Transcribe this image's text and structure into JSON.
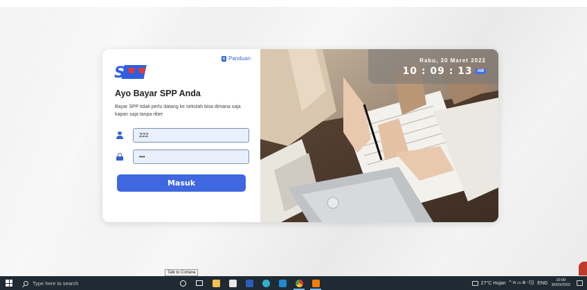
{
  "app": {
    "logo_text": "SPP",
    "guide_link": "Panduan",
    "title": "Ayo Bayar SPP Anda",
    "subtitle": "Bayar SPP tidak perlu datang ke sekolah bisa dimana saja kapan saja tanpa ribet",
    "username_value": "222",
    "password_value": "•••",
    "login_button": "Masuk"
  },
  "clock_panel": {
    "date": "Rabu, 30 Maret 2022",
    "time": "10 : 09 : 13",
    "ampm": "AM"
  },
  "tooltip": "Talk to Cortana",
  "taskbar": {
    "search_placeholder": "Type here to search",
    "pinned_icons": [
      "cortana-icon",
      "task-view-icon",
      "file-explorer-icon",
      "mail-icon",
      "word-icon",
      "edge-icon",
      "vscode-icon",
      "chrome-icon",
      "xampp-icon"
    ],
    "weather": "27°C  Hujan",
    "system_icons": "^  ⍾  ▭  ⊞  ◁))",
    "language": "ENG",
    "time": "10:09",
    "date": "30/03/2022"
  },
  "colors": {
    "accent": "#3f67e0",
    "input_bg": "#e9effb",
    "taskbar": "#1f2a33"
  }
}
